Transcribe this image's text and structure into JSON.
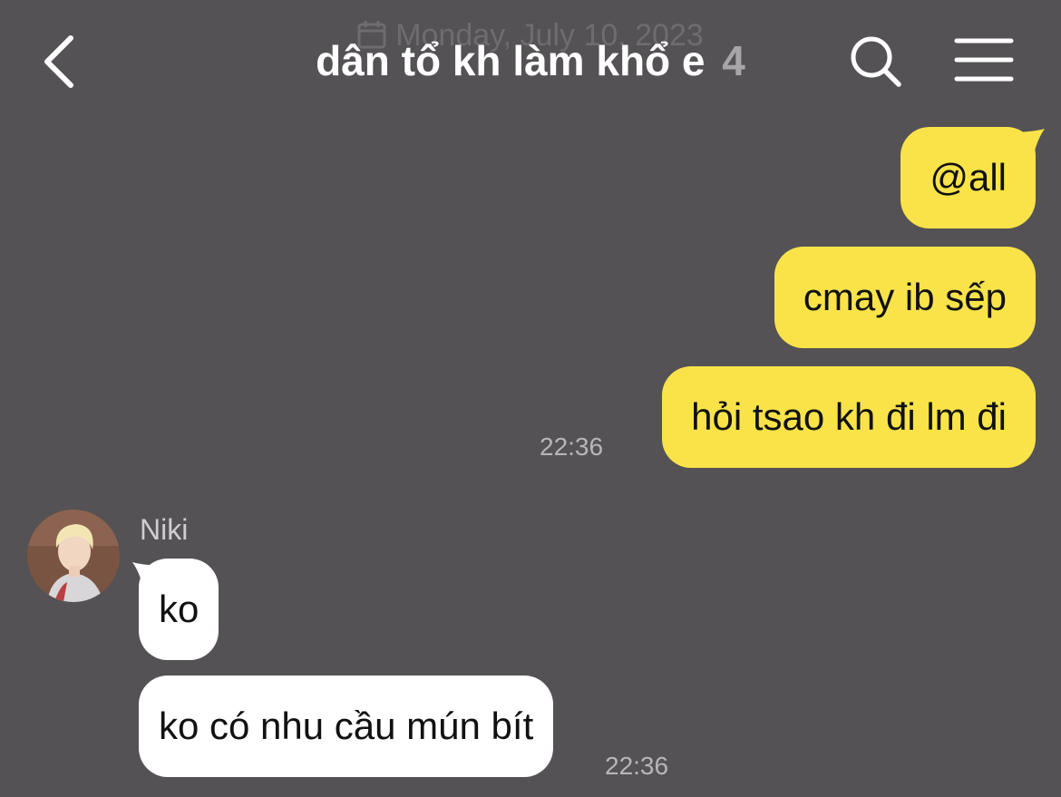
{
  "chat": {
    "date_divider": "Monday, July 10, 2023",
    "title": "dân tổ kh làm khổ e",
    "member_count": "4"
  },
  "messages": {
    "mine": [
      {
        "text": "@all"
      },
      {
        "text": "cmay ib sếp"
      },
      {
        "text": "hỏi tsao kh đi lm đi"
      }
    ],
    "mine_time": "22:36",
    "sender_name": "Niki",
    "theirs": [
      {
        "text": "ko"
      },
      {
        "text": "ko có nhu cầu mún bít"
      }
    ],
    "theirs_time": "22:36"
  },
  "colors": {
    "background": "#545254",
    "my_bubble": "#f9e349",
    "their_bubble": "#ffffff"
  },
  "icons": [
    "back-arrow-icon",
    "search-icon",
    "menu-icon",
    "calendar-icon"
  ]
}
